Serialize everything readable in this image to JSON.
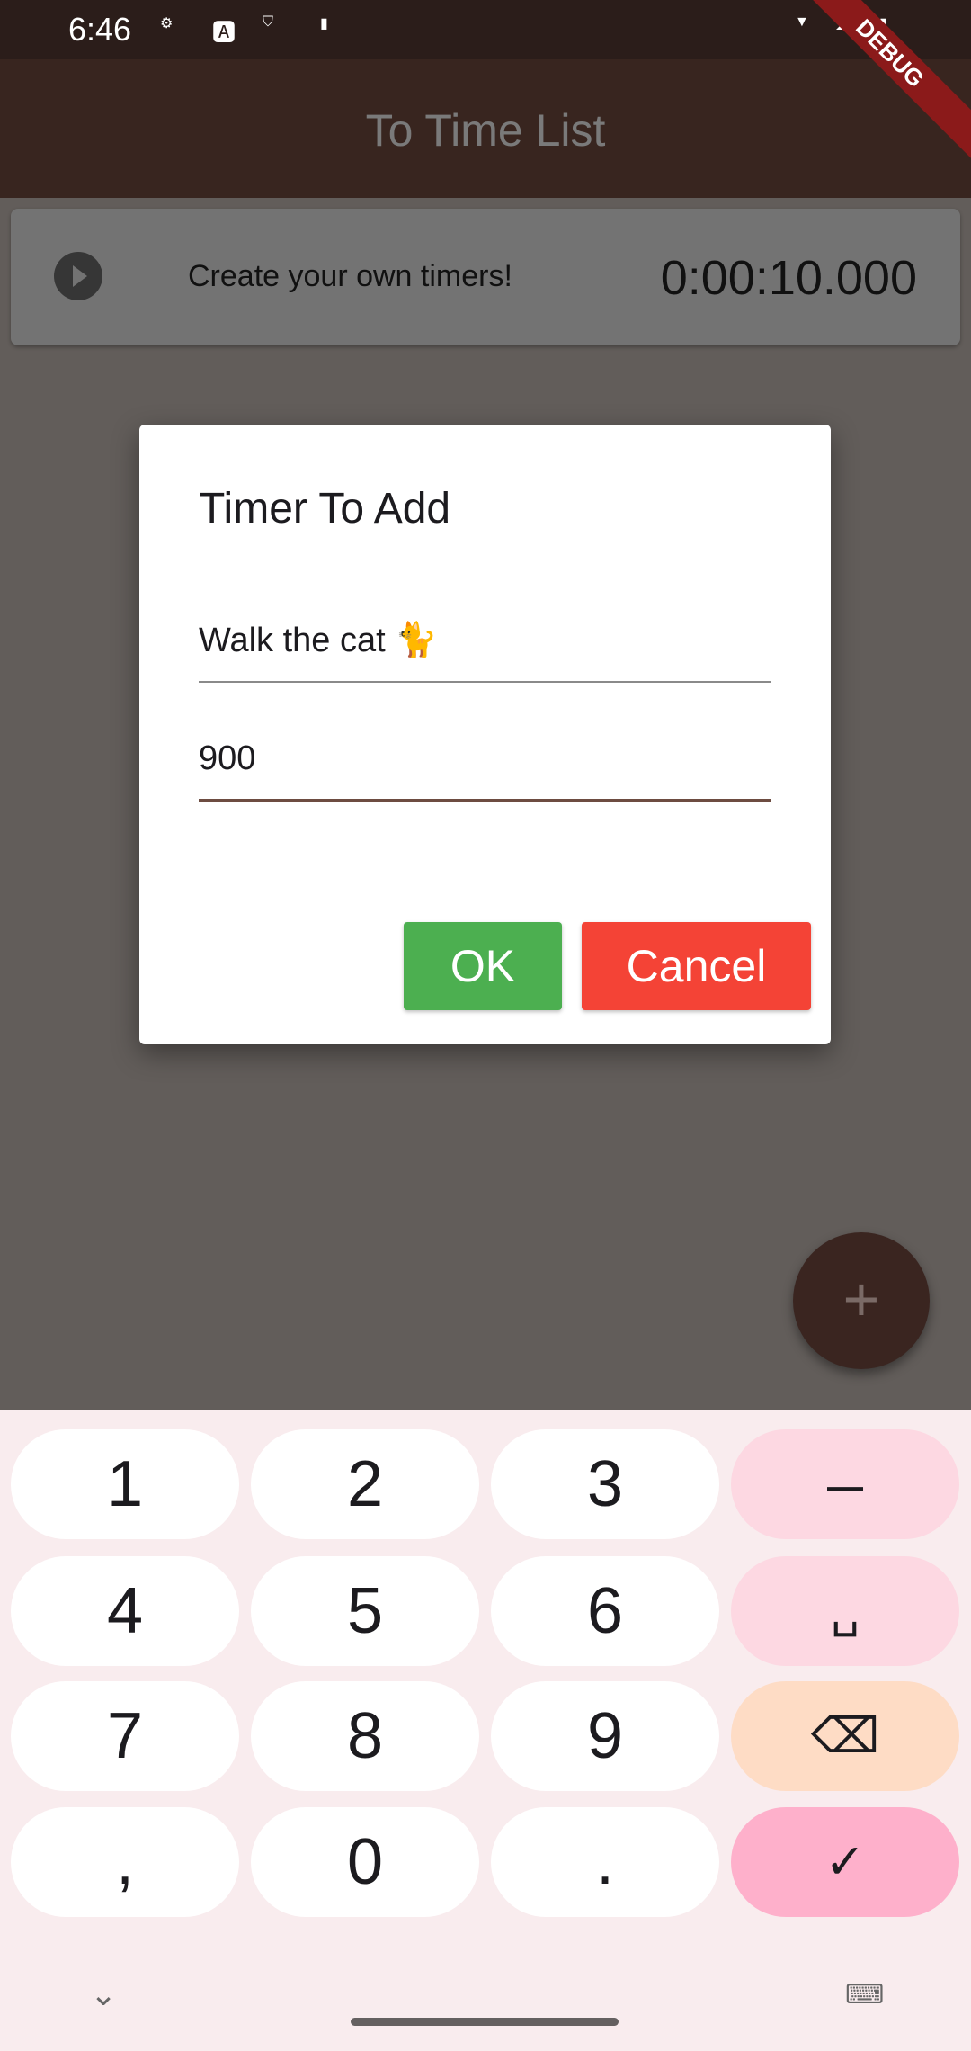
{
  "status": {
    "time": "6:46"
  },
  "debug_banner": "DEBUG",
  "appbar": {
    "title": "To Time List"
  },
  "timer_card": {
    "label": "Create your own timers!",
    "time": "0:00:10.000"
  },
  "dialog": {
    "title": "Timer To Add",
    "name_value": "Walk the cat 🐈",
    "seconds_value": "900",
    "ok": "OK",
    "cancel": "Cancel"
  },
  "fab": {
    "label": "+"
  },
  "keyboard": {
    "keys": [
      "1",
      "2",
      "3",
      "–",
      "4",
      "5",
      "6",
      "␣",
      "7",
      "8",
      "9",
      "⌫",
      ",",
      "0",
      ".",
      "✓"
    ]
  },
  "colors": {
    "ok": "#4caf50",
    "cancel": "#f44336",
    "accent": "#6d4c41"
  }
}
